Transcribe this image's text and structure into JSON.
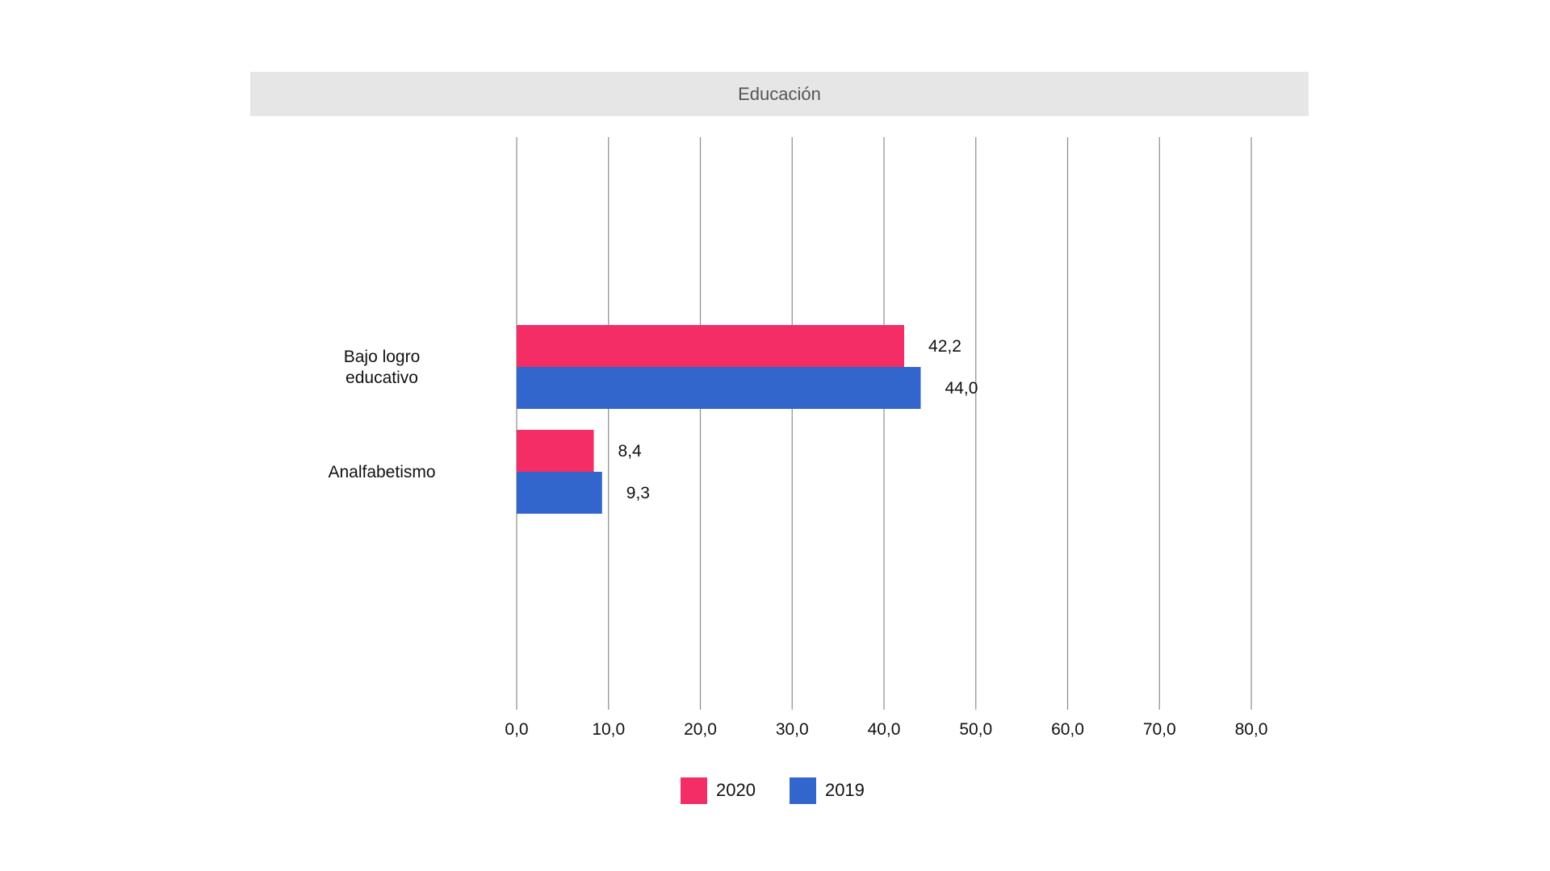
{
  "chart_data": {
    "type": "bar",
    "orientation": "horizontal",
    "title": "Educación",
    "categories": [
      "Bajo logro educativo",
      "Analfabetismo"
    ],
    "category_lines": [
      [
        "Bajo logro",
        "educativo"
      ],
      [
        "Analfabetismo"
      ]
    ],
    "series": [
      {
        "name": "2020",
        "color": "#f42d66",
        "values": [
          42.2,
          8.4
        ],
        "labels": [
          "42,2",
          "8,4"
        ]
      },
      {
        "name": "2019",
        "color": "#3366cc",
        "values": [
          44.0,
          9.3
        ],
        "labels": [
          "44,0",
          "9,3"
        ]
      }
    ],
    "xlim": [
      0,
      80
    ],
    "xticks": [
      0,
      10,
      20,
      30,
      40,
      50,
      60,
      70,
      80
    ],
    "xtick_labels": [
      "0,0",
      "10,0",
      "20,0",
      "30,0",
      "40,0",
      "50,0",
      "60,0",
      "70,0",
      "80,0"
    ],
    "grid": true,
    "legend_position": "bottom",
    "xlabel": "",
    "ylabel": ""
  }
}
